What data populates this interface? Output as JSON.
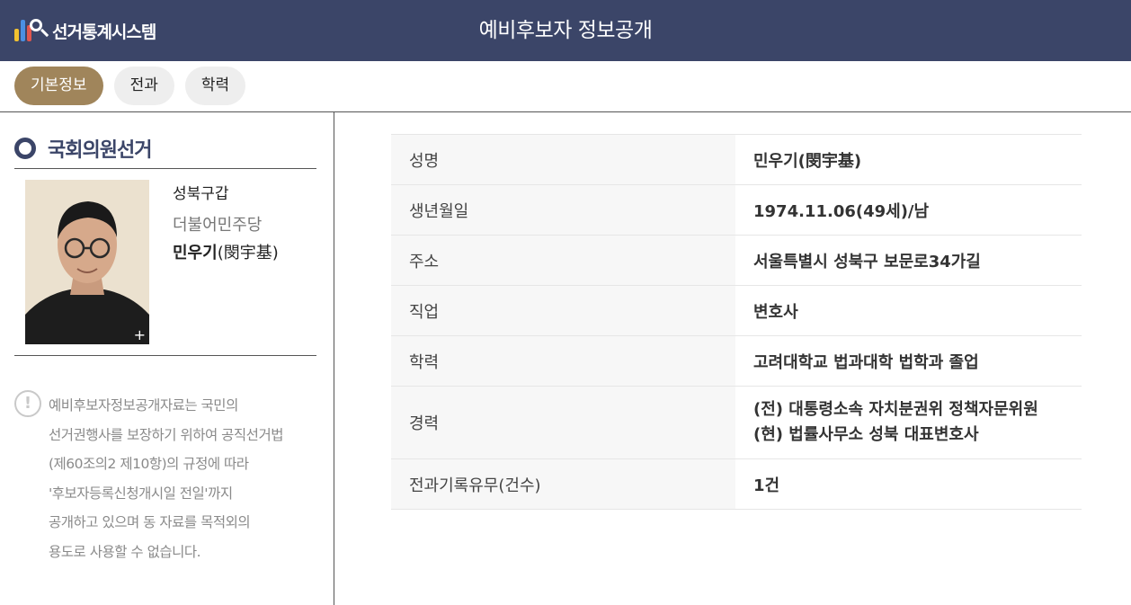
{
  "header": {
    "logo_text": "선거통계시스템",
    "title": "예비후보자 정보공개",
    "colors": {
      "bar": "#3b4568",
      "active_tab": "#a0855b"
    }
  },
  "tabs": [
    {
      "label": "기본정보",
      "active": true
    },
    {
      "label": "전과",
      "active": false
    },
    {
      "label": "학력",
      "active": false
    }
  ],
  "sidebar": {
    "election_title": "국회의원선거",
    "district": "성북구갑",
    "party": "더불어민주당",
    "candidate_name": "민우기",
    "candidate_hanja": "(閔宇基)",
    "photo_expand_symbol": "+",
    "notice_icon": "exclamation-icon",
    "notice_text": "예비후보자정보공개자료는 국민의\n선거권행사를 보장하기 위하여 공직선거법\n(제60조의2 제10항)의 규정에 따라\n'후보자등록신청개시일 전일'까지\n공개하고 있으며 동 자료를 목적외의\n용도로 사용할 수 없습니다."
  },
  "info": {
    "name": {
      "label": "성명",
      "value": "민우기(閔宇基)"
    },
    "birth": {
      "label": "생년월일",
      "value": "1974.11.06(49세)/남"
    },
    "address": {
      "label": "주소",
      "value": "서울특별시 성북구 보문로34가길"
    },
    "job": {
      "label": "직업",
      "value": "변호사"
    },
    "education": {
      "label": "학력",
      "value": "고려대학교 법과대학 법학과 졸업"
    },
    "career": {
      "label": "경력",
      "lines": [
        "(전) 대통령소속 자치분권위 정책자문위원",
        "(현) 법률사무소 성북 대표변호사"
      ]
    },
    "criminal": {
      "label": "전과기록유무(건수)",
      "value": "1건"
    }
  }
}
